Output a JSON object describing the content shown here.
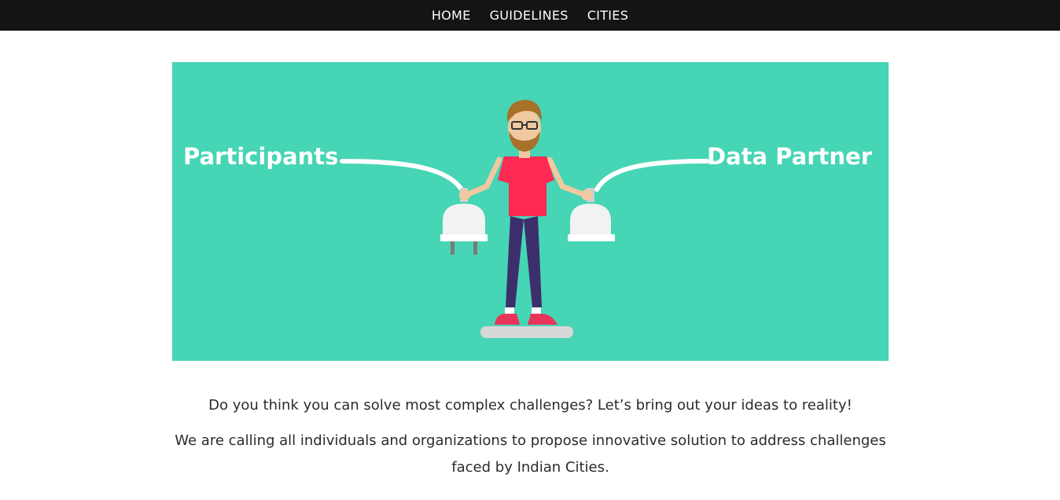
{
  "nav": {
    "items": [
      {
        "label": "HOME"
      },
      {
        "label": "GUIDELINES"
      },
      {
        "label": "CITIES"
      }
    ]
  },
  "hero": {
    "left_label": "Participants",
    "right_label": "Data Partner",
    "background_color": "#46d5b5",
    "illustration": "man-holding-two-plugs"
  },
  "intro": {
    "line1": "Do you think you can solve most complex challenges? Let’s bring out your ideas to reality!",
    "line2": "We are calling all individuals and organizations to propose innovative solution to address challenges faced by Indian Cities."
  }
}
